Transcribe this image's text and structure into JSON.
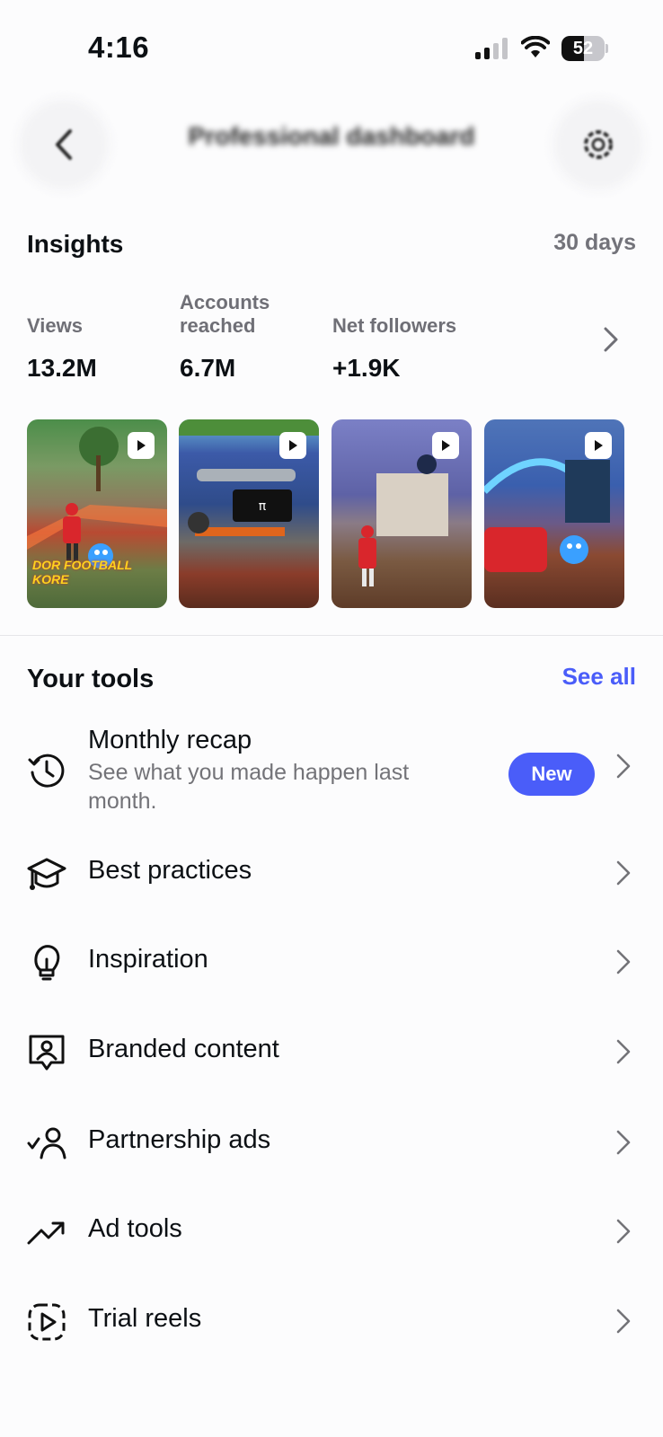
{
  "status_bar": {
    "time": "4:16",
    "battery": "52",
    "battery_level": 0.52
  },
  "header": {
    "title": "Professional dashboard",
    "back_icon": "chevron-left-icon",
    "settings_icon": "gear-icon"
  },
  "insights": {
    "title": "Insights",
    "range": "30 days",
    "metrics": [
      {
        "label": "Views",
        "value": "13.2M"
      },
      {
        "label": "Accounts reached",
        "value": "6.7M"
      },
      {
        "label": "Net followers",
        "value": "+1.9K"
      }
    ],
    "thumbnails": [
      {
        "caption": "DOR FOOTBALL KORE"
      },
      {
        "caption": ""
      },
      {
        "caption": ""
      },
      {
        "caption": ""
      }
    ]
  },
  "tools": {
    "title": "Your tools",
    "see_all": "See all",
    "items": [
      {
        "label": "Monthly recap",
        "sub": "See what you made happen last month.",
        "badge": "New",
        "icon": "history-icon"
      },
      {
        "label": "Best practices",
        "icon": "graduation-cap-icon"
      },
      {
        "label": "Inspiration",
        "icon": "lightbulb-icon"
      },
      {
        "label": "Branded content",
        "icon": "branded-content-icon"
      },
      {
        "label": "Partnership ads",
        "icon": "partnership-icon"
      },
      {
        "label": "Ad tools",
        "icon": "trending-up-icon"
      },
      {
        "label": "Trial reels",
        "icon": "trial-reels-icon"
      }
    ]
  },
  "colors": {
    "accent": "#4a5df9",
    "muted": "#737378",
    "text": "#0c1014"
  }
}
